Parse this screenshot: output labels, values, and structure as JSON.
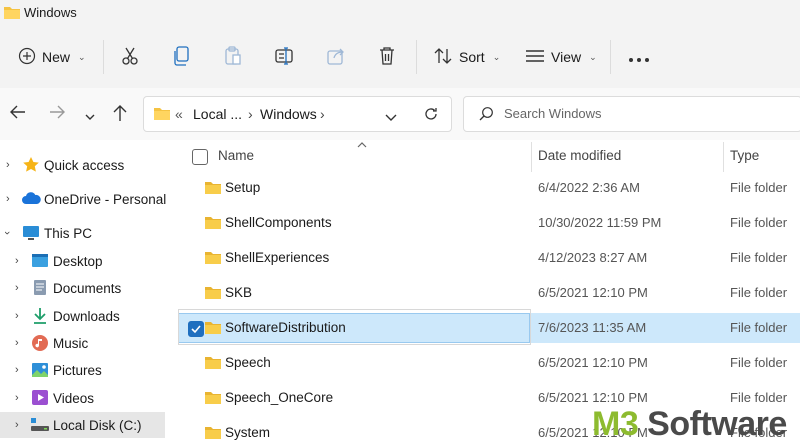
{
  "window": {
    "title": "Windows"
  },
  "toolbar": {
    "new_label": "New",
    "sort_label": "Sort",
    "view_label": "View"
  },
  "address": {
    "overflow": "«",
    "crumb1": "Local ...",
    "sep": "›",
    "crumb2": "Windows",
    "search_placeholder": "Search Windows"
  },
  "sidebar": {
    "items": [
      {
        "label": "Quick access",
        "icon": "star-icon"
      },
      {
        "label": "OneDrive - Personal",
        "icon": "cloud-icon"
      },
      {
        "label": "This PC",
        "icon": "monitor-icon"
      },
      {
        "label": "Desktop",
        "icon": "desktop-icon"
      },
      {
        "label": "Documents",
        "icon": "document-icon"
      },
      {
        "label": "Downloads",
        "icon": "download-icon"
      },
      {
        "label": "Music",
        "icon": "music-icon"
      },
      {
        "label": "Pictures",
        "icon": "picture-icon"
      },
      {
        "label": "Videos",
        "icon": "video-icon"
      },
      {
        "label": "Local Disk (C:)",
        "icon": "drive-icon"
      }
    ]
  },
  "columns": {
    "name": "Name",
    "date": "Date modified",
    "type": "Type"
  },
  "files": [
    {
      "name": "Setup",
      "date": "6/4/2022 2:36 AM",
      "type": "File folder"
    },
    {
      "name": "ShellComponents",
      "date": "10/30/2022 11:59 PM",
      "type": "File folder"
    },
    {
      "name": "ShellExperiences",
      "date": "4/12/2023 8:27 AM",
      "type": "File folder"
    },
    {
      "name": "SKB",
      "date": "6/5/2021 12:10 PM",
      "type": "File folder"
    },
    {
      "name": "SoftwareDistribution",
      "date": "7/6/2023 11:35 AM",
      "type": "File folder",
      "selected": true
    },
    {
      "name": "Speech",
      "date": "6/5/2021 12:10 PM",
      "type": "File folder"
    },
    {
      "name": "Speech_OneCore",
      "date": "6/5/2021 12:10 PM",
      "type": "File folder"
    },
    {
      "name": "System",
      "date": "6/5/2021 12:10 PM",
      "type": "File folder"
    }
  ],
  "watermark": {
    "part1": "M3",
    "part2": " Software"
  },
  "colors": {
    "folder": "#f5c342",
    "selection": "#cde8fb",
    "accent": "#1f6fbf",
    "wm_green": "#8dbb2f",
    "wm_gray": "#4a4a4a"
  }
}
